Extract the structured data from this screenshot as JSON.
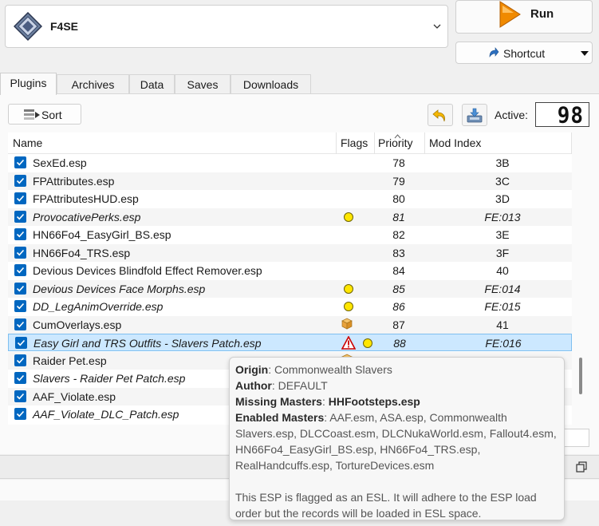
{
  "executable": {
    "label": "F4SE"
  },
  "run": {
    "label": "Run"
  },
  "shortcut": {
    "label": "Shortcut"
  },
  "tabs": [
    "Plugins",
    "Archives",
    "Data",
    "Saves",
    "Downloads"
  ],
  "toolbar": {
    "sort_label": "Sort",
    "active_label": "Active:",
    "active_count": "98"
  },
  "columns": {
    "name": "Name",
    "flags": "Flags",
    "priority": "Priority",
    "mod_index": "Mod Index"
  },
  "plugins": [
    {
      "name": "SexEd.esp",
      "priority": "78",
      "mod_index": "3B",
      "italic": false,
      "flags": []
    },
    {
      "name": "FPAttributes.esp",
      "priority": "79",
      "mod_index": "3C",
      "italic": false,
      "flags": []
    },
    {
      "name": "FPAttributesHUD.esp",
      "priority": "80",
      "mod_index": "3D",
      "italic": false,
      "flags": []
    },
    {
      "name": "ProvocativePerks.esp",
      "priority": "81",
      "mod_index": "FE:013",
      "italic": true,
      "flags": [
        "esl-dot"
      ]
    },
    {
      "name": "HN66Fo4_EasyGirl_BS.esp",
      "priority": "82",
      "mod_index": "3E",
      "italic": false,
      "flags": []
    },
    {
      "name": "HN66Fo4_TRS.esp",
      "priority": "83",
      "mod_index": "3F",
      "italic": false,
      "flags": []
    },
    {
      "name": "Devious Devices Blindfold Effect Remover.esp",
      "priority": "84",
      "mod_index": "40",
      "italic": false,
      "flags": []
    },
    {
      "name": "Devious Devices Face Morphs.esp",
      "priority": "85",
      "mod_index": "FE:014",
      "italic": true,
      "flags": [
        "esl-dot"
      ]
    },
    {
      "name": "DD_LegAnimOverride.esp",
      "priority": "86",
      "mod_index": "FE:015",
      "italic": true,
      "flags": [
        "esl-dot"
      ]
    },
    {
      "name": "CumOverlays.esp",
      "priority": "87",
      "mod_index": "41",
      "italic": false,
      "flags": [
        "archive-box"
      ]
    },
    {
      "name": "Easy Girl and TRS Outfits - Slavers Patch.esp",
      "priority": "88",
      "mod_index": "FE:016",
      "italic": true,
      "flags": [
        "warning",
        "esl-dot"
      ],
      "selected": true
    },
    {
      "name": "Raider Pet.esp",
      "priority": "",
      "mod_index": "",
      "italic": false,
      "flags": [
        "archive-box"
      ]
    },
    {
      "name": "Slavers - Raider Pet Patch.esp",
      "priority": "",
      "mod_index": "",
      "italic": true,
      "flags": []
    },
    {
      "name": "AAF_Violate.esp",
      "priority": "",
      "mod_index": "",
      "italic": false,
      "flags": []
    },
    {
      "name": "AAF_Violate_DLC_Patch.esp",
      "priority": "",
      "mod_index": "",
      "italic": true,
      "flags": []
    }
  ],
  "tooltip": {
    "origin_label": "Origin",
    "origin_value": "Commonwealth Slavers",
    "author_label": "Author",
    "author_value": "DEFAULT",
    "missing_label": "Missing Masters",
    "missing_value": "HHFootsteps.esp",
    "enabled_label": "Enabled Masters",
    "enabled_lines": [
      "AAF.esm, ASA.esp, Commonwealth",
      "Slavers.esp, DLCCoast.esm, DLCNukaWorld.esm, Fallout4.esm,",
      "HN66Fo4_EasyGirl_BS.esp, HN66Fo4_TRS.esp,",
      "RealHandcuffs.esp, TortureDevices.esm"
    ],
    "esl_note_lines": [
      "This ESP is flagged as an ESL. It will adhere to the ESP load",
      "order but the records will be loaded in ESL space."
    ]
  },
  "icons": {
    "executable": "f4se-diamond-icon",
    "run": "run-arrow-icon",
    "shortcut": "shortcut-arrow-icon",
    "sort": "sort-icon",
    "undo": "undo-icon",
    "save": "save-tray-icon",
    "restore": "restore-window-icon"
  },
  "colors": {
    "checkbox": "#0067c0",
    "selection": "#cce8ff",
    "esl_dot": "#ffe600",
    "warning": "#cc0000",
    "run_arrow": "#f08a00"
  }
}
